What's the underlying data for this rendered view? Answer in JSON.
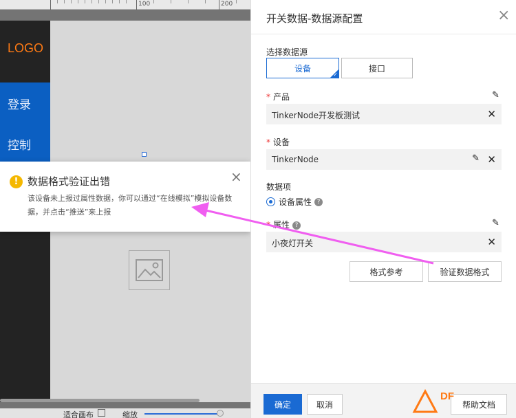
{
  "ruler": {
    "labels": [
      "100",
      "200"
    ]
  },
  "mock_app": {
    "logo": "LOGO",
    "nav_items": [
      "登录",
      "控制"
    ]
  },
  "canvas_bottom": {
    "fit_label": "适合画布",
    "zoom_label": "缩放"
  },
  "toast": {
    "icon": "warning-icon",
    "icon_glyph": "!",
    "title": "数据格式验证出错",
    "message": "该设备未上报过属性数据，你可以通过“在线模拟”模拟设备数据，并点击“推送”来上报",
    "close": "×"
  },
  "panel": {
    "title": "开关数据-数据源配置",
    "close": "×",
    "source_label": "选择数据源",
    "source_options": [
      "设备",
      "接口"
    ],
    "source_selected": "设备",
    "product": {
      "label": "产品",
      "value": "TinkerNode开发板测试"
    },
    "device": {
      "label": "设备",
      "value": "TinkerNode"
    },
    "data_item": {
      "label": "数据项",
      "option": "设备属性"
    },
    "property": {
      "label": "属性",
      "value": "小夜灯开关"
    },
    "format_ref_button": "格式参考",
    "validate_button": "验证数据格式",
    "confirm_button": "确定",
    "cancel_button": "取消",
    "help_doc_button": "帮助文档"
  },
  "watermark": {
    "text": "DF"
  },
  "colors": {
    "primary": "#1a6ad3",
    "warning": "#f5b800",
    "required": "#e33333",
    "annotation_arrow": "#f05ef0",
    "logo_orange": "#ff7a14"
  }
}
